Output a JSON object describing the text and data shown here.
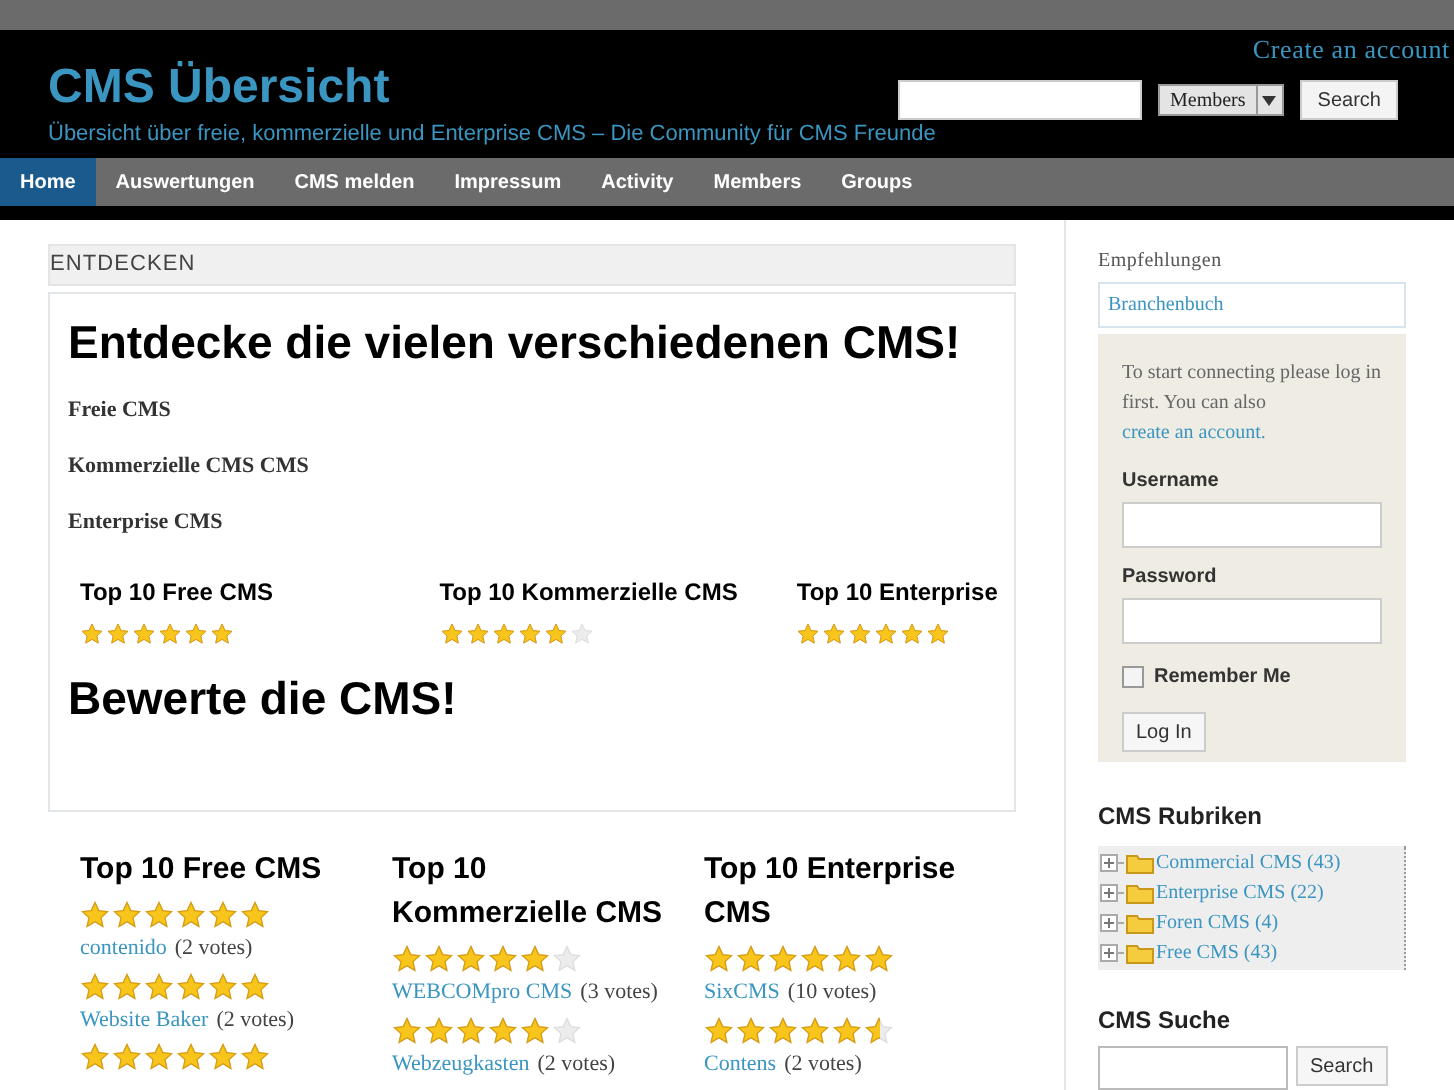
{
  "header": {
    "create_account": "Create an account",
    "title": "CMS Übersicht",
    "tagline": "Übersicht über freie, kommerzielle und Enterprise CMS – Die Community für CMS Freunde",
    "search": {
      "scope": "Members",
      "button": "Search"
    }
  },
  "nav": [
    {
      "label": "Home",
      "selected": true
    },
    {
      "label": "Auswertungen",
      "selected": false
    },
    {
      "label": "CMS melden",
      "selected": false
    },
    {
      "label": "Impressum",
      "selected": false
    },
    {
      "label": "Activity",
      "selected": false
    },
    {
      "label": "Members",
      "selected": false
    },
    {
      "label": "Groups",
      "selected": false
    }
  ],
  "discover": {
    "section_label": "ENTDECKEN",
    "heading": "Entdecke die vielen verschiedenen CMS!",
    "links": [
      "Freie CMS",
      "Kommerzielle CMS CMS",
      "Enterprise CMS"
    ],
    "tops": [
      {
        "title": "Top 10 Free CMS",
        "stars": 6
      },
      {
        "title": "Top 10 Kommerzielle CMS",
        "stars": 5
      },
      {
        "title": "Top 10 Enterprise",
        "stars": 6
      }
    ],
    "rate_heading": "Bewerte die CMS!"
  },
  "top_lists": [
    {
      "title": "Top 10 Free CMS",
      "entries": [
        {
          "stars": 6,
          "name": "contenido",
          "votes": "(2 votes)"
        },
        {
          "stars": 6,
          "name": "Website Baker",
          "votes": "(2 votes)"
        },
        {
          "stars": 6
        }
      ]
    },
    {
      "title": "Top 10 Kommerzielle CMS",
      "entries": [
        {
          "stars": 5,
          "name": "WEBCOMpro CMS",
          "votes": "(3 votes)"
        },
        {
          "stars": 5,
          "name": "Webzeugkasten",
          "votes": "(2 votes)"
        }
      ]
    },
    {
      "title": "Top 10 Enterprise CMS",
      "entries": [
        {
          "stars": 6,
          "name": "SixCMS",
          "votes": "(10 votes)"
        },
        {
          "stars": 5.5,
          "name": "Contens",
          "votes": "(2 votes)"
        }
      ]
    }
  ],
  "sidebar": {
    "recommend_label": "Empfehlungen",
    "recommend_link": "Branchenbuch",
    "login": {
      "intro": "To start connecting please log in first. You can also",
      "intro_link": "create an account.",
      "username_label": "Username",
      "password_label": "Password",
      "remember": "Remember Me",
      "remember_checked": false,
      "button": "Log In"
    },
    "categories_title": "CMS Rubriken",
    "categories": [
      {
        "label": "Commercial CMS (43)",
        "expanded": false
      },
      {
        "label": "Enterprise CMS (22)",
        "expanded": false
      },
      {
        "label": "Foren CMS (4)",
        "expanded": false
      },
      {
        "label": "Free CMS (43)",
        "expanded": false
      }
    ],
    "search_title": "CMS Suche",
    "search_button": "Search"
  }
}
